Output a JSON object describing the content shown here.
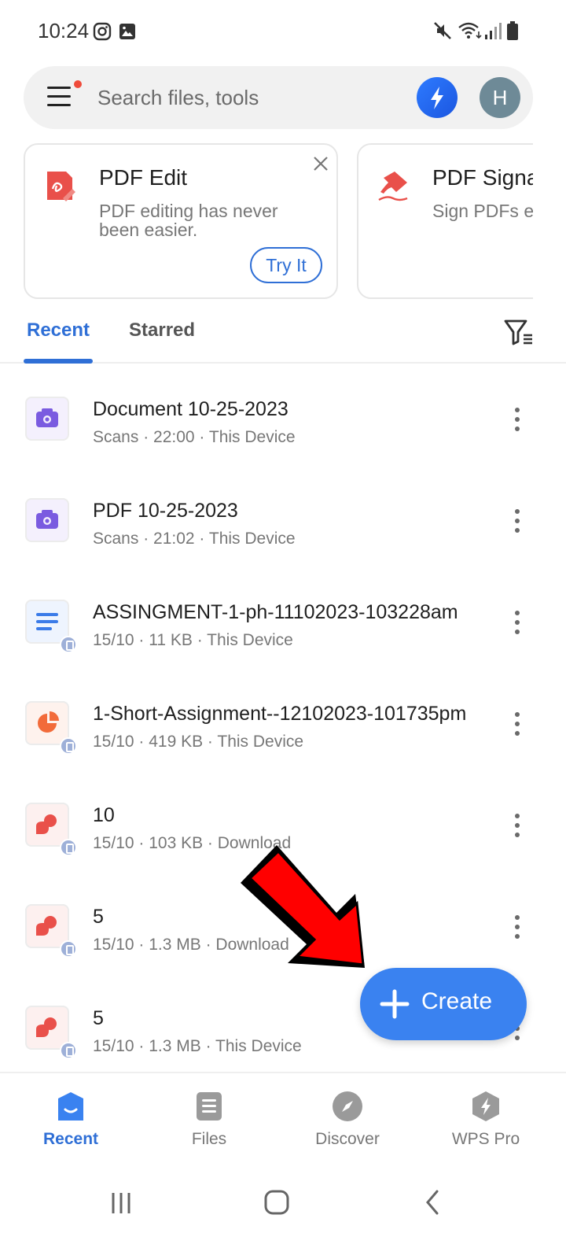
{
  "status_bar": {
    "time": "10:24",
    "left_icons": [
      "instagram-icon",
      "gallery-icon"
    ],
    "right_icons": [
      "mute-icon",
      "wifi-icon",
      "signal-icon",
      "battery-icon"
    ]
  },
  "search": {
    "placeholder": "Search files, tools",
    "avatar_letter": "H"
  },
  "promos": [
    {
      "title": "PDF Edit",
      "description": "PDF editing has never been easier.",
      "button": "Try It",
      "icon": "pdf-edit-icon"
    },
    {
      "title": "PDF Signature",
      "description": "Sign PDFs easily",
      "icon": "pdf-signature-icon"
    }
  ],
  "tabs": [
    {
      "label": "Recent",
      "active": true
    },
    {
      "label": "Starred",
      "active": false
    }
  ],
  "files": [
    {
      "name": "Document 10-25-2023",
      "meta": "Scans · 22:00 · This Device",
      "type": "scan",
      "badge": false
    },
    {
      "name": "PDF 10-25-2023",
      "meta": "Scans · 21:02 · This Device",
      "type": "scan",
      "badge": false
    },
    {
      "name": "ASSINGMENT-1-ph-11102023-103228am",
      "meta": "15/10 · 11 KB · This Device",
      "type": "doc",
      "badge": true
    },
    {
      "name": "1-Short-Assignment--12102023-101735pm",
      "meta": "15/10 · 419 KB · This Device",
      "type": "ppt",
      "badge": true
    },
    {
      "name": "10",
      "meta": "15/10 · 103 KB · Download",
      "type": "pdf",
      "badge": true
    },
    {
      "name": "5",
      "meta": "15/10 · 1.3 MB · Download",
      "type": "pdf",
      "badge": true
    },
    {
      "name": "5",
      "meta": "15/10 · 1.3 MB · This Device",
      "type": "pdf",
      "badge": true
    }
  ],
  "fab": {
    "label": "Create"
  },
  "bottom_nav": [
    {
      "label": "Recent",
      "icon": "recent-icon",
      "active": true
    },
    {
      "label": "Files",
      "icon": "files-icon",
      "active": false
    },
    {
      "label": "Discover",
      "icon": "compass-icon",
      "active": false
    },
    {
      "label": "WPS Pro",
      "icon": "wps-pro-icon",
      "active": false
    }
  ],
  "colors": {
    "accent": "#2f6fd6",
    "fab": "#3a82f0",
    "pdf_red": "#e9504a",
    "scan_purple": "#7a5be0",
    "doc_blue": "#3b7be8",
    "ppt_orange": "#f26b3a",
    "annotation_arrow": "#ff0000"
  }
}
